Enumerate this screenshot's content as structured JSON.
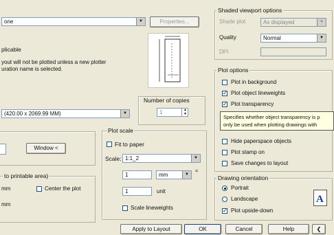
{
  "top_left": {
    "combo_text": "one",
    "properties_button": "Properties...",
    "heading": "plicable",
    "message_line1": "yout will not be plotted unless a new plotter",
    "message_line2": "uration name is selected."
  },
  "paper_size": {
    "value": "(420.00 x 2069.99 MM)"
  },
  "copies": {
    "title": "Number of copies",
    "value": "1"
  },
  "plot_area": {
    "window_button": "Window <"
  },
  "plot_offset": {
    "title": "to printable area)",
    "x_unit": "mm",
    "center_label": "Center the plot",
    "y_unit": "mm"
  },
  "plot_scale": {
    "title": "Plot scale",
    "fit_label": "Fit to paper",
    "scale_label": "Scale:",
    "scale_value": "1:1_2",
    "value1": "1",
    "unit1": "mm",
    "value2": "1",
    "unit2": "unit",
    "lineweights_label": "Scale lineweights"
  },
  "shaded": {
    "title": "Shaded viewport options",
    "shade_plot_label": "Shade plot",
    "shade_plot_value": "As displayed",
    "quality_label": "Quality",
    "quality_value": "Normal",
    "dpi_label": "DPI"
  },
  "plot_options": {
    "title": "Plot options",
    "items": [
      {
        "label": "Plot in background",
        "checked": false
      },
      {
        "label": "Plot object lineweights",
        "checked": true
      },
      {
        "label": "Plot transparency",
        "checked": true
      },
      {
        "label": "Hide paperspace objects",
        "checked": false
      },
      {
        "label": "Plot stamp on",
        "checked": false
      },
      {
        "label": "Save changes to layout",
        "checked": false
      }
    ]
  },
  "tooltip": {
    "line1": "Specifies whether object transparency is p",
    "line2": "only be used when plotting drawings with"
  },
  "orientation": {
    "title": "Drawing orientation",
    "portrait": "Portrait",
    "landscape": "Landscape",
    "upside_down": "Plot upside-down",
    "selected": "portrait"
  },
  "bottom_bar": {
    "apply": "Apply to Layout",
    "ok": "OK",
    "cancel": "Cancel",
    "help": "Help",
    "more_glyph": "❮"
  },
  "colors": {
    "dialog_bg": "#ece9d8",
    "tooltip_bg": "#ffffe1",
    "orientation_icon": "#1b3f8b"
  }
}
